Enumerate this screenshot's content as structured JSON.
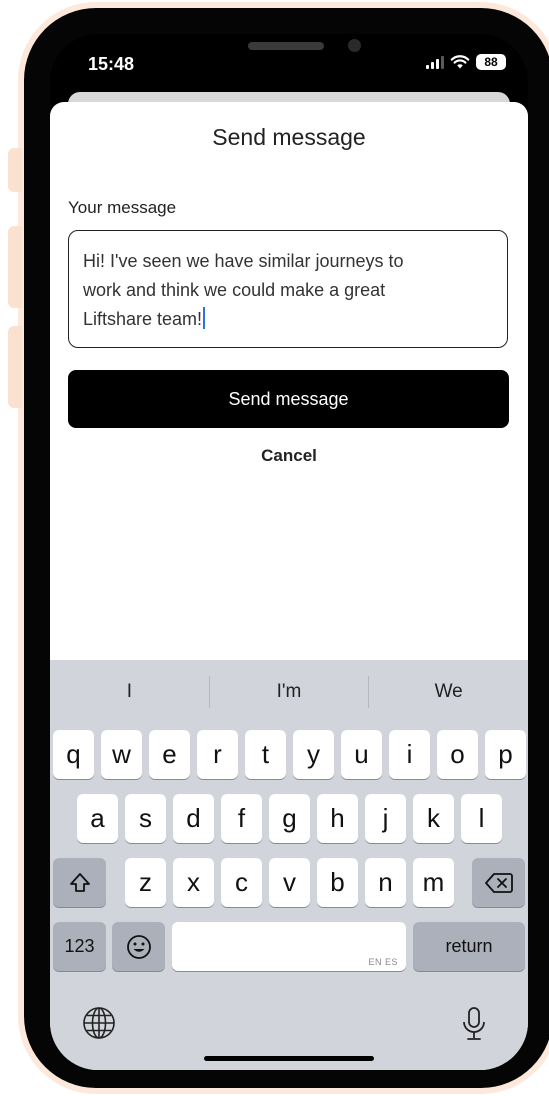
{
  "status_bar": {
    "time": "15:48",
    "battery": "88"
  },
  "sheet": {
    "title": "Send message",
    "field_label": "Your message",
    "message_lines": [
      "Hi! I've seen we have similar journeys to",
      "work and think we could make a great",
      "Liftshare team!"
    ],
    "send_label": "Send message",
    "cancel_label": "Cancel"
  },
  "keyboard": {
    "suggestions": [
      "I",
      "I'm",
      "We"
    ],
    "row1": [
      "q",
      "w",
      "e",
      "r",
      "t",
      "y",
      "u",
      "i",
      "o",
      "p"
    ],
    "row2": [
      "a",
      "s",
      "d",
      "f",
      "g",
      "h",
      "j",
      "k",
      "l"
    ],
    "row3": [
      "z",
      "x",
      "c",
      "v",
      "b",
      "n",
      "m"
    ],
    "numbers_label": "123",
    "space_language": "EN ES",
    "return_label": "return"
  },
  "colors": {
    "frame_accent": "#fde9dc",
    "keyboard_bg": "#d1d4da",
    "caret": "#2f6fe0"
  }
}
